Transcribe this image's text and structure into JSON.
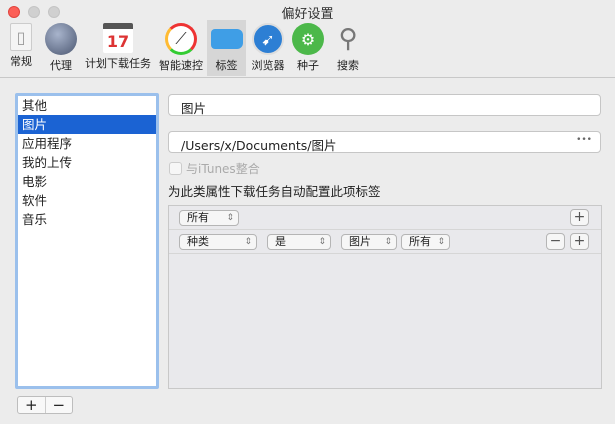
{
  "window": {
    "title": "偏好设置"
  },
  "toolbar": [
    {
      "label": "常规",
      "icon": "switch-icon"
    },
    {
      "label": "代理",
      "icon": "globe-icon"
    },
    {
      "label": "计划下载任务",
      "icon": "calendar-icon",
      "badge": "17"
    },
    {
      "label": "智能速控",
      "icon": "speedometer-icon"
    },
    {
      "label": "标签",
      "icon": "tag-icon",
      "selected": true
    },
    {
      "label": "浏览器",
      "icon": "compass-icon"
    },
    {
      "label": "种子",
      "icon": "gear-icon"
    },
    {
      "label": "搜索",
      "icon": "magnifier-icon"
    }
  ],
  "tags": [
    "其他",
    "图片",
    "应用程序",
    "我的上传",
    "电影",
    "软件",
    "音乐"
  ],
  "selected_tag": "图片",
  "name_field": "图片",
  "path_field": "/Users/x/Documents/图片",
  "path_more": "•••",
  "itunes_checkbox": {
    "label": "与iTunes整合",
    "checked": false,
    "disabled": true
  },
  "rules_heading": "为此类属性下载任务自动配置此项标签",
  "rules": {
    "match": "所有",
    "conditions": [
      {
        "field": "种类",
        "op": "是",
        "value": "图片",
        "scope": "所有"
      }
    ]
  },
  "buttons": {
    "plus": "+",
    "minus": "−"
  }
}
